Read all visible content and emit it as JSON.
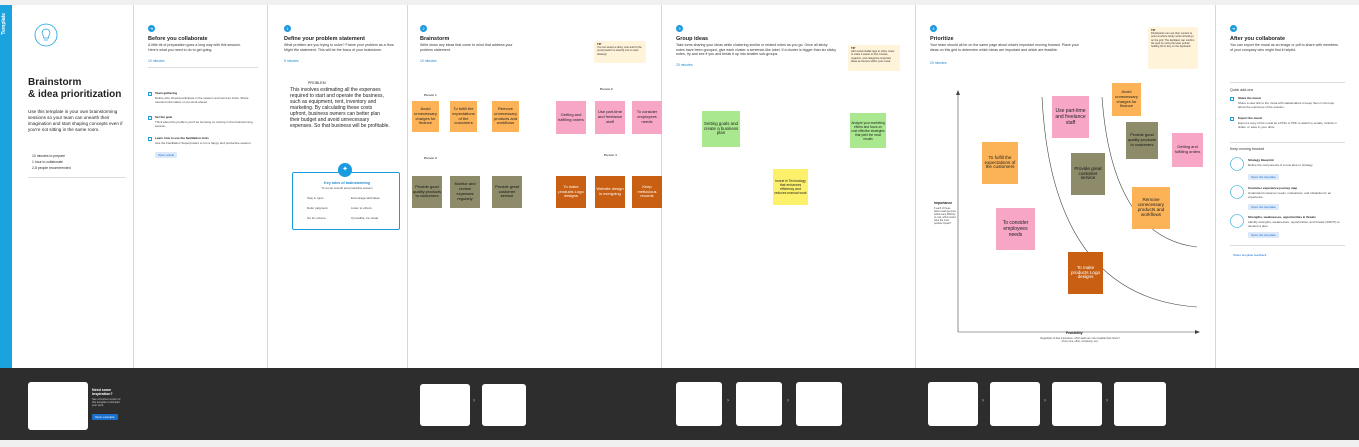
{
  "sidebar_label": "Template",
  "intro": {
    "title_line1": "Brainstorm",
    "title_line2": "& idea prioritization",
    "description": "Use this template in your own brainstorming sessions so your team can unearth their imagination and start shaping concepts even if you're not sitting in the same room.",
    "stat1": "10 minutes to prepare",
    "stat2": "1 hour to collaborate",
    "stat3": "2-8 people recommended"
  },
  "before": {
    "title": "Before you collaborate",
    "desc": "A little bit of preparation goes a long way with this session. Here's what you need to do to get going.",
    "time": "10 minutes",
    "step_a_title": "Team gathering",
    "step_a_desc": "Define who should participate in the session and send an invite. Share relevant information or pre-work ahead.",
    "step_b_title": "Set the goal",
    "step_b_desc": "Think about the problem you'll be focusing on solving in the brainstorming session.",
    "step_c_title": "Learn how to use the facilitation tools",
    "step_c_desc": "Use the Facilitation Superpowers to run a happy and productive session.",
    "open_article": "Open article"
  },
  "define": {
    "title": "Define your problem statement",
    "desc": "What problem are you trying to solve? Frame your problem as a How Might We statement. This will be the focus of your brainstorm.",
    "time": "5 minutes",
    "problem_label": "PROBLEM",
    "problem_text": "This involves estimating all the expenses required to start and operate the business, such as equipment, rent, inventory and marketing. By calculating these costs upfront, business owners can better plan their budget and avoid unnecessary expenses. So that business will be profitable.",
    "rules_title": "Key rules of brainstorming",
    "rules_sub": "To run an smooth and productive session",
    "rule1": "Stay in topic.",
    "rule2": "Encourage wild ideas.",
    "rule3": "Defer judgment.",
    "rule4": "Listen to others.",
    "rule5": "Go for volume.",
    "rule6": "If possible, be visual."
  },
  "brainstorm": {
    "title": "Brainstorm",
    "desc": "Write down any ideas that come to mind that address your problem statement.",
    "time": "10 minutes",
    "tip_label": "TIP",
    "tip_text": "You can select a sticky note and hit the pencil [switch to sketch] icon to start drawing!",
    "person1": "Person 1",
    "person2": "Person 2",
    "person3": "Person 3",
    "person4": "Person 4",
    "notes": [
      "Avoid unnecessary charges for finance",
      "To fulfill the expectations of the customers",
      "Remove unnecessary products and workflows",
      "Getting and fulfilling orders",
      "Use part-time and freelance staff",
      "To consider employees needs",
      "Provide good quality products to customers",
      "Monitor and review expenses regularly",
      "Provide great customer service",
      "To make products Logo designs",
      "Website design is evergoing",
      "Keep meticulous records"
    ]
  },
  "group": {
    "title": "Group ideas",
    "desc": "Take turns sharing your ideas while clustering similar or related notes as you go. Once all sticky notes have been grouped, give each cluster a sentence-like label. If a cluster is bigger than six sticky notes, try and see if you and break it up into smaller sub-groups.",
    "time": "20 minutes",
    "tip_label": "TIP",
    "tip_text": "Add customizable tags to sticky notes to make it easier to find, browse, organize, and categorize important ideas as themes within your mural.",
    "note1": "Setting goals and create a business plan",
    "note2": "Analyze your marketing efforts and focus on cost effective strategies that yield the most results",
    "note3": "Invest in Technology that enhances efficiency and reduces manual work"
  },
  "prioritize": {
    "title": "Prioritize",
    "desc": "Your team should all be on the same page about what's important moving forward. Place your ideas on this grid to determine which ideas are important and which are feasible.",
    "time": "20 minutes",
    "tip_label": "TIP",
    "tip_text": "Participants can use their cursors to point at where sticky notes should go on the grid. The facilitator can confirm the spot by using the laser pointer holding the H key on the keyboard.",
    "ylabel": "Importance",
    "ydesc": "If each of these tasks could get done without any difficulty or cost, which would have the most positive impact?",
    "xlabel": "Feasibility",
    "xdesc": "Regardless of their importance, which tasks are more feasible than others? (Cost, time, effort, complexity, etc.)",
    "notes": [
      "Avoid unnecessary charges for finance",
      "Use part-time and freelance staff",
      "Provide good quality products to customers",
      "Getting and fulfilling orders",
      "To fulfill the expectations of the customers",
      "Provide great customer service",
      "Remove unnecessary products and workflows",
      "To consider employees needs",
      "To make products Logo designs"
    ]
  },
  "after": {
    "title": "After you collaborate",
    "desc": "You can export the mural as an image or pdf to share with members of your company who might find it helpful.",
    "quick_title": "Quick add-ons",
    "qa1_title": "Share the mural",
    "qa1_desc": "Share a view link to the mural with stakeholders to keep them in the loop about the outcomes of the session.",
    "qa2_title": "Export the mural",
    "qa2_desc": "Export a copy of the mural as a PNG or PDF to attach to emails, include in slides, or save in your drive.",
    "keep_title": "Keep moving forward",
    "kf1_title": "Strategy blueprint",
    "kf1_desc": "Define the components of a new idea or strategy.",
    "kf2_title": "Customer experience journey map",
    "kf2_desc": "Understand customer needs, motivations, and obstacles for an experience.",
    "kf3_title": "Strengths, weaknesses, opportunities & threats",
    "kf3_desc": "Identify strengths, weaknesses, opportunities, and threats (SWOT) to develop a plan.",
    "open_template": "Open the template",
    "feedback": "Share template feedback"
  },
  "bottom": {
    "inspire_title": "Need some inspiration?",
    "inspire_desc": "See a finished version of this template to kickstart your work.",
    "open_example": "Open example"
  },
  "colors": {
    "accent": "#1aa3dd",
    "orange_note": "#fcb358",
    "pink_note": "#f7a6c6",
    "olive_note": "#8d8b6a",
    "rust_note": "#c85f12",
    "green_note": "#a9e88f",
    "yellow_note": "#fdf06b"
  }
}
